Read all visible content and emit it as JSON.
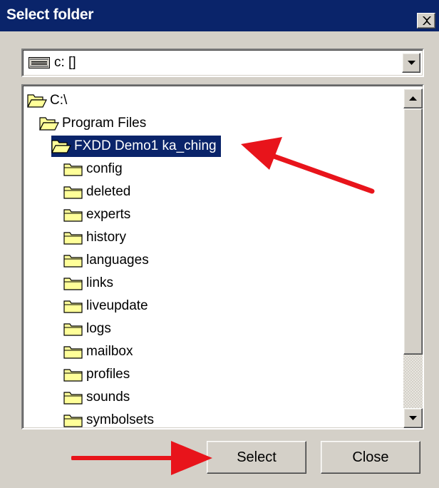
{
  "window": {
    "title": "Select folder",
    "close_icon": "close-icon"
  },
  "drive": {
    "value": "c: []",
    "icon": "drive-icon"
  },
  "tree": {
    "items": [
      {
        "label": "C:\\",
        "icon": "open-folder-icon",
        "depth": 0,
        "selected": false
      },
      {
        "label": "Program Files",
        "icon": "open-folder-icon",
        "depth": 1,
        "selected": false
      },
      {
        "label": "FXDD Demo1 ka_ching",
        "icon": "open-folder-icon",
        "depth": 2,
        "selected": true
      },
      {
        "label": "config",
        "icon": "folder-icon",
        "depth": 3,
        "selected": false
      },
      {
        "label": "deleted",
        "icon": "folder-icon",
        "depth": 3,
        "selected": false
      },
      {
        "label": "experts",
        "icon": "folder-icon",
        "depth": 3,
        "selected": false
      },
      {
        "label": "history",
        "icon": "folder-icon",
        "depth": 3,
        "selected": false
      },
      {
        "label": "languages",
        "icon": "folder-icon",
        "depth": 3,
        "selected": false
      },
      {
        "label": "links",
        "icon": "folder-icon",
        "depth": 3,
        "selected": false
      },
      {
        "label": "liveupdate",
        "icon": "folder-icon",
        "depth": 3,
        "selected": false
      },
      {
        "label": "logs",
        "icon": "folder-icon",
        "depth": 3,
        "selected": false
      },
      {
        "label": "mailbox",
        "icon": "folder-icon",
        "depth": 3,
        "selected": false
      },
      {
        "label": "profiles",
        "icon": "folder-icon",
        "depth": 3,
        "selected": false
      },
      {
        "label": "sounds",
        "icon": "folder-icon",
        "depth": 3,
        "selected": false
      },
      {
        "label": "symbolsets",
        "icon": "folder-icon",
        "depth": 3,
        "selected": false
      }
    ]
  },
  "buttons": {
    "select_label": "Select",
    "close_label": "Close"
  },
  "colors": {
    "title_bar": "#0a246a",
    "selection": "#0a246a",
    "face": "#d4d0c8",
    "folder": "#ffff99",
    "annotation_arrow": "#e8141b"
  }
}
